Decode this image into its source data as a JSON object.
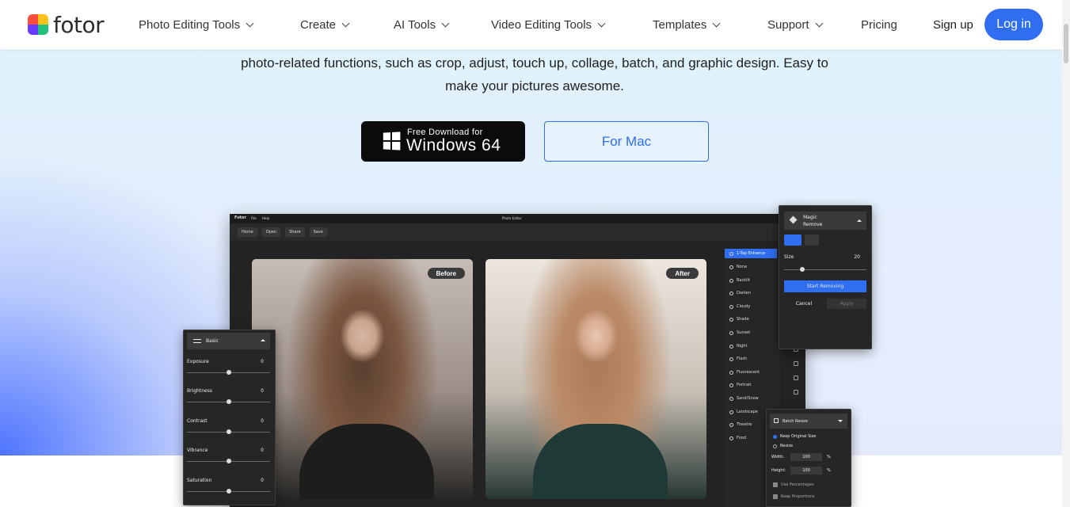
{
  "header": {
    "logo_text": "fotor",
    "nav": [
      {
        "label": "Photo Editing Tools",
        "has_dropdown": true
      },
      {
        "label": "Create",
        "has_dropdown": true
      },
      {
        "label": "AI Tools",
        "has_dropdown": true
      },
      {
        "label": "Video Editing Tools",
        "has_dropdown": true
      },
      {
        "label": "Templates",
        "has_dropdown": true
      },
      {
        "label": "Support",
        "has_dropdown": true
      },
      {
        "label": "Pricing",
        "has_dropdown": false
      }
    ],
    "signup_label": "Sign up",
    "login_label": "Log in"
  },
  "hero": {
    "line1": "photo-related functions, such as crop, adjust, touch up, collage, batch, and graphic design. Easy to",
    "line2": "make your pictures awesome.",
    "windows_button": {
      "small": "Free Download for",
      "big": "Windows 64"
    },
    "mac_button_label": "For Mac"
  },
  "editor": {
    "app_name": "Fotor",
    "menu": [
      "File",
      "Help"
    ],
    "window_title": "Photo Editor",
    "toolbar": [
      "Home",
      "Open",
      "Share",
      "Save"
    ],
    "before_label": "Before",
    "after_label": "After",
    "presets": [
      "1-Tap Enhance",
      "None",
      "Backlit",
      "Darken",
      "Cloudy",
      "Shade",
      "Sunset",
      "Night",
      "Flash",
      "Fluorescent",
      "Portrait",
      "Sand/Snow",
      "Landscape",
      "Theatre",
      "Food"
    ]
  },
  "basic_panel": {
    "title": "Basic",
    "sliders": [
      {
        "label": "Exposure",
        "value": "0"
      },
      {
        "label": "Brightness",
        "value": "0"
      },
      {
        "label": "Contrast",
        "value": "0"
      },
      {
        "label": "Vibrance",
        "value": "0"
      },
      {
        "label": "Saturation",
        "value": "0"
      }
    ]
  },
  "magic_panel": {
    "title_line1": "Magic",
    "title_line2": "Remove",
    "size_label": "Size",
    "size_value": "20",
    "start_label": "Start Removing",
    "cancel_label": "Cancel",
    "apply_label": "Apply"
  },
  "batch_panel": {
    "title": "Batch Resize",
    "keep_original": "Keep Original Size",
    "resize": "Resize",
    "width_label": "Width:",
    "width_value": "100",
    "height_label": "Height:",
    "height_value": "100",
    "unit": "%",
    "use_percentages": "Use Percentages",
    "keep_proportions": "Keep Proportions"
  },
  "colors": {
    "accent": "#2f6ef0",
    "dark_ui": "#232323"
  }
}
